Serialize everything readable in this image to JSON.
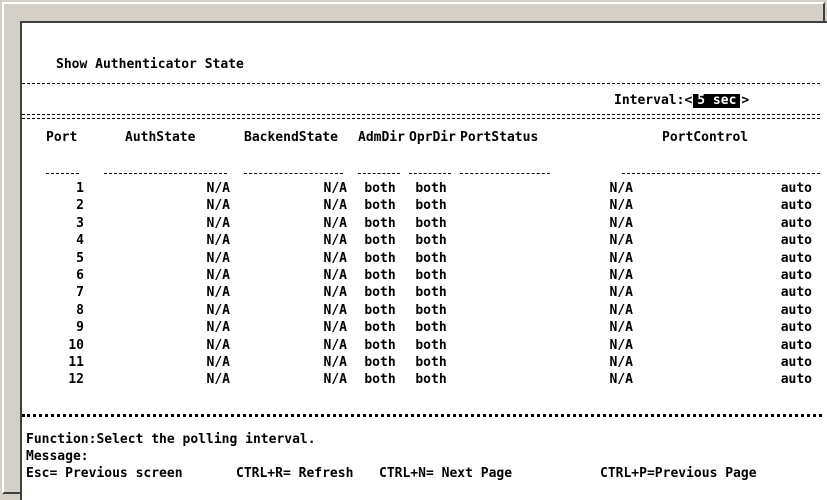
{
  "title": "Show Authenticator State",
  "interval": {
    "label": "Interval:",
    "left_bracket": "<",
    "value": "5 sec",
    "right_bracket": ">"
  },
  "table": {
    "headers": [
      "Port",
      "AuthState",
      "BackendState",
      "AdmDir",
      "OprDir",
      "PortStatus",
      "PortControl"
    ],
    "rows": [
      [
        "1",
        "N/A",
        "N/A",
        "both",
        "both",
        "N/A",
        "auto"
      ],
      [
        "2",
        "N/A",
        "N/A",
        "both",
        "both",
        "N/A",
        "auto"
      ],
      [
        "3",
        "N/A",
        "N/A",
        "both",
        "both",
        "N/A",
        "auto"
      ],
      [
        "4",
        "N/A",
        "N/A",
        "both",
        "both",
        "N/A",
        "auto"
      ],
      [
        "5",
        "N/A",
        "N/A",
        "both",
        "both",
        "N/A",
        "auto"
      ],
      [
        "6",
        "N/A",
        "N/A",
        "both",
        "both",
        "N/A",
        "auto"
      ],
      [
        "7",
        "N/A",
        "N/A",
        "both",
        "both",
        "N/A",
        "auto"
      ],
      [
        "8",
        "N/A",
        "N/A",
        "both",
        "both",
        "N/A",
        "auto"
      ],
      [
        "9",
        "N/A",
        "N/A",
        "both",
        "both",
        "N/A",
        "auto"
      ],
      [
        "10",
        "N/A",
        "N/A",
        "both",
        "both",
        "N/A",
        "auto"
      ],
      [
        "11",
        "N/A",
        "N/A",
        "both",
        "both",
        "N/A",
        "auto"
      ],
      [
        "12",
        "N/A",
        "N/A",
        "both",
        "both",
        "N/A",
        "auto"
      ]
    ]
  },
  "function_text": "Function:Select the polling interval.",
  "message_label": "Message:",
  "help": {
    "esc": "Esc= Previous screen",
    "refresh": "CTRL+R= Refresh",
    "next_page": "CTRL+N= Next Page",
    "prev_page": "CTRL+P=Previous Page"
  }
}
